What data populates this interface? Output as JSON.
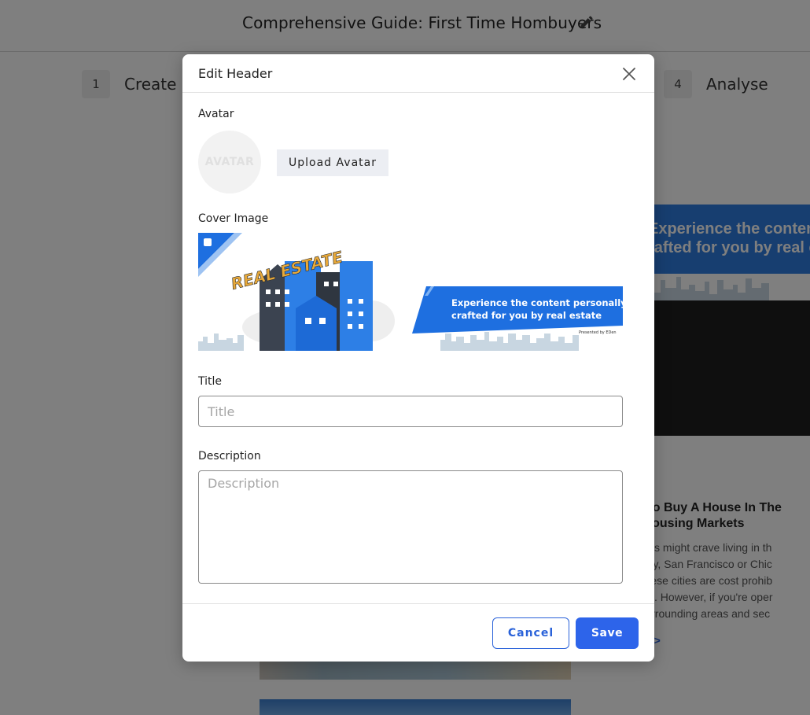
{
  "page": {
    "doc_title": "Comprehensive Guide: First Time Hombuyers",
    "steps": [
      {
        "num": "1",
        "label": "Create"
      },
      {
        "num": "4",
        "label": "Analyse"
      }
    ],
    "bg_card": {
      "line1": "Experience the content pe",
      "line2": "rafted for you by real est"
    },
    "bg_article": {
      "title_line1": "ces To Buy A House In The",
      "title_line2": "ble Housing Markets",
      "text_lines": [
        "ny of us might crave living in th",
        "ork City, San Francisco or Chic",
        "s in these cities are cost prohib",
        "buyers. However, if you're oper",
        "the surrounding areas and sec"
      ],
      "more": "e >"
    }
  },
  "modal": {
    "title": "Edit Header",
    "avatar_label": "Avatar",
    "avatar_placeholder": "AVATAR",
    "upload_label": "Upload Avatar",
    "cover_label": "Cover Image",
    "cover": {
      "brand": "REAL ESTATE",
      "tagline_1": "Experience the content personally",
      "tagline_2": "crafted for you by real estate",
      "presented": "Presented by EDen"
    },
    "title_label": "Title",
    "title_placeholder": "Title",
    "description_label": "Description",
    "description_placeholder": "Description",
    "cancel_label": "Cancel",
    "save_label": "Save"
  },
  "colors": {
    "accent": "#2d64ea",
    "overlay": "rgba(0,0,0,0.5)",
    "cover_blue": "#1e6fe0"
  },
  "icons": {
    "title_edit": "pencil-icon",
    "close": "close-icon"
  }
}
